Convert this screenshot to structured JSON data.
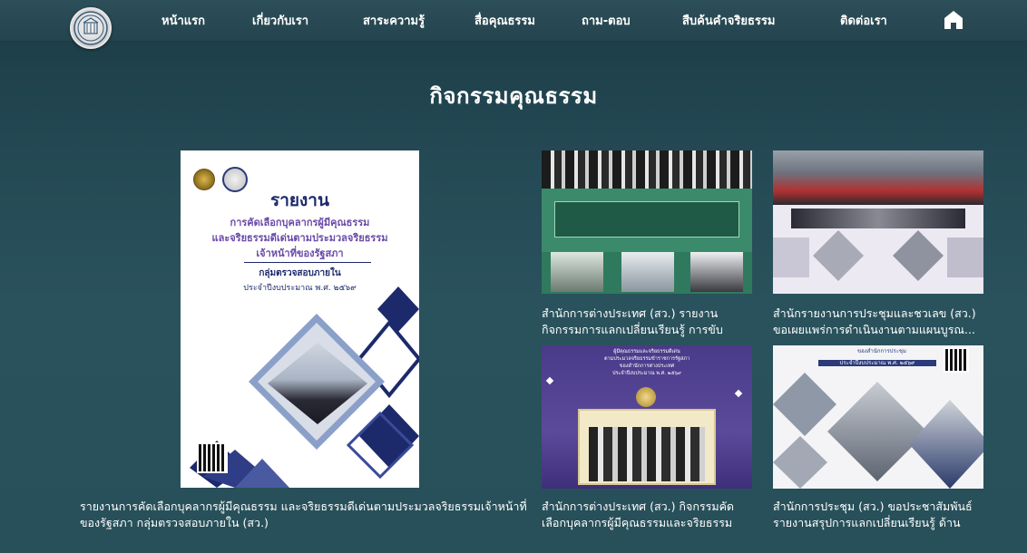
{
  "nav": {
    "items": [
      {
        "label": "หน้าแรก"
      },
      {
        "label": "เกี่ยวกับเรา"
      },
      {
        "label": "สาระความรู้"
      },
      {
        "label": "สื่อคุณธรรม"
      },
      {
        "label": "ถาม-ตอบ"
      },
      {
        "label": "สืบค้นคำจริยธรรม"
      },
      {
        "label": "ติดต่อเรา"
      }
    ],
    "home_icon": "home-icon",
    "logo_icon": "parliament-seal-icon"
  },
  "page": {
    "title": "กิจกรรมคุณธรรม"
  },
  "cards": [
    {
      "caption": "รายงานการคัดเลือกบุคลากรผู้มีคุณธรรม และจริยธรรมดีเด่นตามประมวลจริยธรรมเจ้าหน้าที่ของรัฐสภา กลุ่มตรวจสอบภายใน (สว.)",
      "poster": {
        "title": "รายงาน",
        "line1": "การคัดเลือกบุคลากรผู้มีคุณธรรม",
        "line2": "และจริยธรรมดีเด่นตามประมวลจริยธรรม",
        "line3": "เจ้าหน้าที่ของรัฐสภา",
        "unit": "กลุ่มตรวจสอบภายใน",
        "year": "ประจำปีงบประมาณ พ.ศ. ๒๕๖๙"
      }
    },
    {
      "caption": "สำนักการต่างประเทศ (สว.) รายงานกิจกรรมการแลกเปลี่ยนเรียนรู้ การขับ"
    },
    {
      "caption": "สำนักรายงานการประชุมและชวเลข (สว.) ขอเผยแพร่การดำเนินงานตามแผนบูรณ..."
    },
    {
      "caption": "สำนักการต่างประเทศ (สว.) กิจกรรมคัดเลือกบุคลากรผู้มีคุณธรรมและจริยธรรม",
      "thumb": {
        "line1": "ผู้มีคุณธรรมและจริยธรรมดีเด่น",
        "line2": "ตามประมวลจริยธรรมข้าราชการรัฐสภา",
        "line3": "ของสำนักการต่างประเทศ",
        "line4": "ประจำปีงบประมาณ พ.ศ. ๒๕๖๙"
      }
    },
    {
      "caption": "สำนักการประชุม (สว.) ขอประชาสัมพันธ์รายงานสรุปการแลกเปลี่ยนเรียนรู้ ด้าน",
      "thumb": {
        "line1": "ของสำนักการประชุม",
        "line2": "ประจำปีงบประมาณ พ.ศ. ๒๕๖๙"
      }
    }
  ],
  "colors": {
    "nav_bg": "#2d4f59",
    "page_bg": "#234853",
    "poster_navy": "#1c2a6b",
    "poster_purple": "#6a4aa8"
  }
}
